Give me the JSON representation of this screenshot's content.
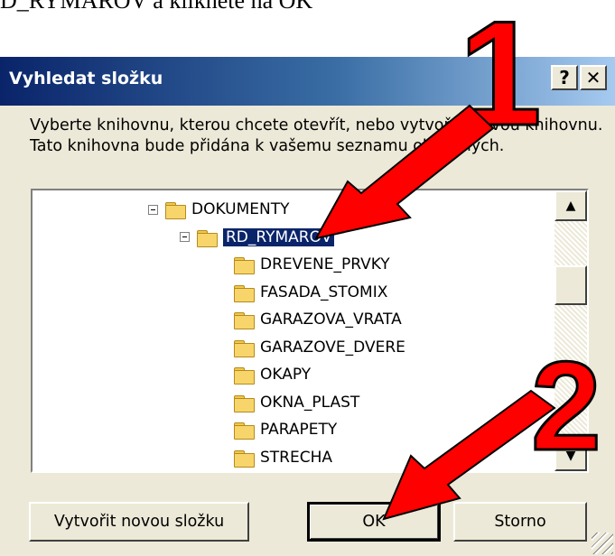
{
  "header_text": "D_RYMAROV a klikněte na OK",
  "dialog": {
    "title": "Vyhledat složku",
    "help_button": "?",
    "close_button": "✕",
    "instruction_line1": "Vyberte knihovnu, kterou chcete otevřít, nebo vytvořte novou knihovnu.",
    "instruction_line2": "Tato knihovna bude přidána k vašemu seznamu oblíbených."
  },
  "tree": {
    "items": [
      {
        "label": "DOKUMENTY",
        "level": 0,
        "expanded": true
      },
      {
        "label": "RD_RYMAROV",
        "level": 1,
        "expanded": true,
        "selected": true
      },
      {
        "label": "DREVENE_PRVKY",
        "level": 2
      },
      {
        "label": "FASADA_STOMIX",
        "level": 2
      },
      {
        "label": "GARAZOVA_VRATA",
        "level": 2
      },
      {
        "label": "GARAZOVE_DVERE",
        "level": 2
      },
      {
        "label": "OKAPY",
        "level": 2
      },
      {
        "label": "OKNA_PLAST",
        "level": 2
      },
      {
        "label": "PARAPETY",
        "level": 2
      },
      {
        "label": "STRECHA",
        "level": 2
      }
    ]
  },
  "buttons": {
    "new_folder": "Vytvořit novou složku",
    "ok": "OK",
    "cancel": "Storno"
  },
  "annotations": {
    "step1": "1",
    "step2": "2",
    "arrow_color": "#ff0000"
  },
  "colors": {
    "title_gradient_start": "#0a246a",
    "title_gradient_end": "#a6caf0",
    "dialog_bg": "#ece9d8",
    "selection_bg": "#0a246a",
    "folder": "#f7d56b"
  }
}
